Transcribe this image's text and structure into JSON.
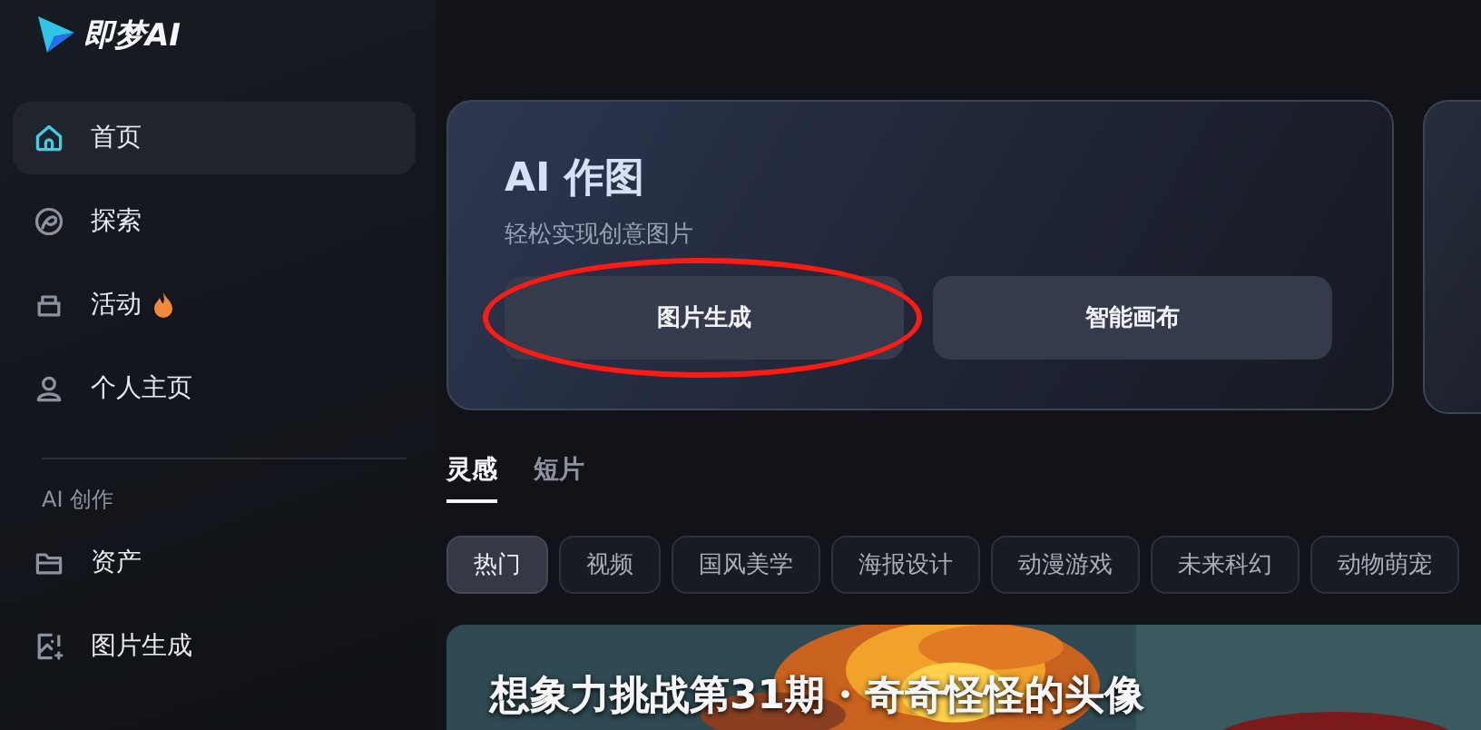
{
  "logo": {
    "text": "即梦AI"
  },
  "sidebar": {
    "items": [
      {
        "label": "首页",
        "selected": true
      },
      {
        "label": "探索",
        "selected": false
      },
      {
        "label": "活动",
        "selected": false,
        "hot": true
      },
      {
        "label": "个人主页",
        "selected": false
      }
    ],
    "section_title": "AI 创作",
    "section_items": [
      {
        "label": "资产",
        "selected": false
      },
      {
        "label": "图片生成",
        "selected": false
      }
    ]
  },
  "hero_card": {
    "title": "AI 作图",
    "subtitle": "轻松实现创意图片",
    "buttons": [
      {
        "label": "图片生成",
        "circled": true
      },
      {
        "label": "智能画布",
        "circled": false
      }
    ]
  },
  "tabs": [
    {
      "label": "灵感",
      "selected": true
    },
    {
      "label": "短片",
      "selected": false
    }
  ],
  "chips": [
    {
      "label": "热门",
      "selected": true
    },
    {
      "label": "视频",
      "selected": false
    },
    {
      "label": "国风美学",
      "selected": false
    },
    {
      "label": "海报设计",
      "selected": false
    },
    {
      "label": "动漫游戏",
      "selected": false
    },
    {
      "label": "未来科幻",
      "selected": false
    },
    {
      "label": "动物萌宠",
      "selected": false
    }
  ],
  "banner": {
    "kind": "picture",
    "title": "想象力挑战第31期・奇奇怪怪的头像"
  }
}
